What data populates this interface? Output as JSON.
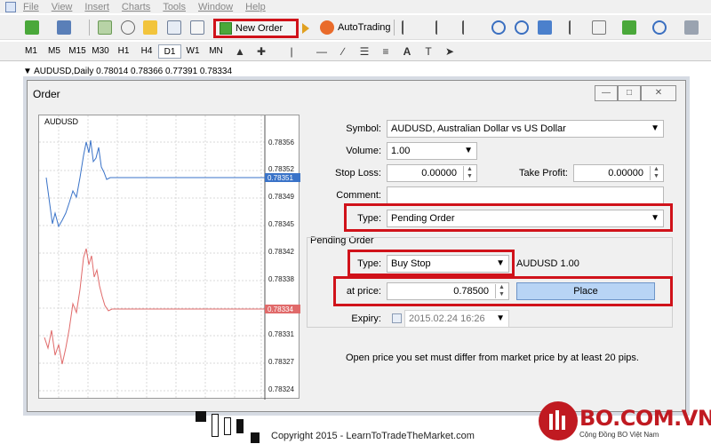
{
  "menu": [
    "File",
    "View",
    "Insert",
    "Charts",
    "Tools",
    "Window",
    "Help"
  ],
  "toolbar": {
    "new_order_label": "New Order",
    "autotrading_label": "AutoTrading"
  },
  "timeframes": [
    "M1",
    "M5",
    "M15",
    "M30",
    "H1",
    "H4",
    "D1",
    "W1",
    "MN"
  ],
  "active_timeframe": "D1",
  "chart_header": "AUDUSD,Daily  0.78014 0.78366 0.77391 0.78334",
  "dialog": {
    "title": "Order",
    "mini_chart": {
      "symbol": "AUDUSD",
      "price_levels": [
        "0.78356",
        "0.78352",
        "0.78351",
        "0.78349",
        "0.78345",
        "0.78342",
        "0.78338",
        "0.78334",
        "0.78331",
        "0.78327",
        "0.78324"
      ],
      "ask_tag": "0.78351",
      "bid_tag": "0.78334"
    },
    "symbol_label": "Symbol:",
    "symbol_value": "AUDUSD, Australian Dollar vs US Dollar",
    "volume_label": "Volume:",
    "volume_value": "1.00",
    "stop_loss_label": "Stop Loss:",
    "stop_loss_value": "0.00000",
    "take_profit_label": "Take Profit:",
    "take_profit_value": "0.00000",
    "comment_label": "Comment:",
    "comment_value": "",
    "type_label": "Type:",
    "type_value": "Pending Order",
    "pending_group_label": "Pending Order",
    "pending_type_label": "Type:",
    "pending_type_value": "Buy Stop",
    "pending_symbol_text": "AUDUSD 1.00",
    "at_price_label": "at price:",
    "at_price_value": "0.78500",
    "place_label": "Place",
    "expiry_label": "Expiry:",
    "expiry_value": "2015.02.24 16:26",
    "note": "Open price you set must differ from market price by at least 20 pips."
  },
  "footer": {
    "copyright": "Copyright 2015 - LearnToTradeTheMarket.com",
    "brand": "BO.COM.VN",
    "brand_sub": "Cộng Đồng BO Việt Nam"
  },
  "colors": {
    "highlight_red": "#d0121a",
    "ask_line": "#3a73c8",
    "bid_line": "#e06a6a",
    "brand_red": "#c01a21"
  }
}
